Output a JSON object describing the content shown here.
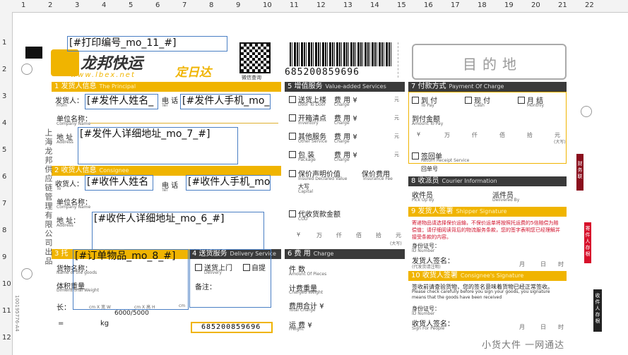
{
  "ruler": {
    "top_numbers": [
      "1",
      "2",
      "3",
      "4",
      "5",
      "6",
      "7",
      "8",
      "9",
      "10",
      "11",
      "12",
      "13",
      "14",
      "15",
      "16",
      "17",
      "18",
      "19",
      "20",
      "21",
      "22"
    ],
    "left_numbers": [
      "1",
      "2",
      "3",
      "4",
      "5",
      "6",
      "7",
      "8",
      "9",
      "10",
      "11",
      "12"
    ]
  },
  "fields": {
    "print_no": "[#打印编号_mo_11_#]",
    "sender_name": "[#发件人姓名_",
    "sender_phone": "[#发件人手机_mo_",
    "sender_address": "[#发件人详细地址_mo_7_#]",
    "recv_name": "[#收件人姓名",
    "recv_phone": "[#收件人手机_mo",
    "recv_address": "[#收件人详细地址_mo_6_#]",
    "goods": "[#订单物品_mo_8_#]"
  },
  "brand": {
    "logo_cn": "龙邦快运",
    "url": "www.lbex.net",
    "slogan": "定日达",
    "qr_caption": "微信查询"
  },
  "waybill": {
    "number": "685200859696",
    "destination": "目的地"
  },
  "principal": {
    "title": "1 发货人信息",
    "title_en": "The Principal",
    "sender": "发货人：",
    "sender_en": "From",
    "phone": "电 话",
    "phone_en": "Tel",
    "company": "单位名称：",
    "company_en": "Company Name",
    "address": "地 址",
    "address_en": "Address"
  },
  "consignee": {
    "title": "2 收货人信息",
    "title_en": "Consignee",
    "receiver": "收货人：",
    "receiver_en": "To",
    "phone": "电 话",
    "phone_en": "Tel",
    "company": "单位名称：",
    "company_en": "Company Name",
    "address": "地 址：",
    "address_en": "Address"
  },
  "section3": {
    "title": "3 托",
    "goods": "货物名称：",
    "goods_en": "Name of the goods",
    "volume": "体积重量",
    "volume_en": "Dimensional Weight",
    "length": "长：",
    "cm_w": "cm X 宽 W",
    "cm_h": "cm X 高 H",
    "cm": "cm",
    "ratio": "6000/5000",
    "eq": "=",
    "kg": "kg"
  },
  "section4": {
    "title": "4 送货服务",
    "title_en": "Delivery Service",
    "door": "送货上门",
    "door_en": "Delivery",
    "pickup": "自提",
    "remark": "备注："
  },
  "section5": {
    "title": "5 增值服务",
    "title_en": "Value-added Services",
    "rows": [
      {
        "label": "送货上楼",
        "en": "Door To Door"
      },
      {
        "label": "开箱清点",
        "en": "Inventory"
      },
      {
        "label": "其他服务",
        "en": "Other Service"
      },
      {
        "label": "包 装",
        "en": "Package"
      }
    ],
    "fee": "费 用",
    "fee_unit": "¥",
    "fee_en": "Charge",
    "yuan": "元",
    "insured": "保价声明价值",
    "insured_en": "Insured Declared Value",
    "insurance_fee": "保价费用",
    "insurance_fee_en": "Insurance Fee",
    "capital": "大写",
    "capital_en": "Capital",
    "cod": "代收货款金额",
    "cod_en": "COD",
    "units": [
      "¥",
      "万",
      "仟",
      "佰",
      "拾",
      "元"
    ],
    "units_cap": "(大写)"
  },
  "section6": {
    "title": "6 费 用",
    "title_en": "Charge",
    "pieces": "件 数",
    "pieces_en": "Amount Of Pieces",
    "weight": "计费重量",
    "weight_en": "Charged Weight",
    "total": "费用合计",
    "total_unit": "¥",
    "total_en": "Total Charge",
    "freight": "运 费",
    "freight_unit": "¥",
    "freight_en": "Freight"
  },
  "section7": {
    "title": "7 付款方式",
    "title_en": "Payment Of Charge",
    "options": [
      {
        "label": "到 付",
        "en": "To Pay"
      },
      {
        "label": "现 付",
        "en": "Cash"
      },
      {
        "label": "月 结",
        "en": "Monthly"
      }
    ],
    "cod_amount": "到付金额",
    "cod_amount_en": "Amount To Pay",
    "units": [
      "¥",
      "万",
      "仟",
      "佰",
      "拾",
      "元"
    ],
    "units_cap": "(大写)",
    "receipt": "签回单",
    "receipt_en": "Return Receipt Service",
    "receipt_no": "回单号"
  },
  "section8": {
    "title": "8 收派员",
    "title_en": "Courier Information",
    "pickup": "收件员",
    "pickup_en": "Pick Up By",
    "deliver": "派件员",
    "deliver_en": "Delivered By"
  },
  "section9": {
    "title": "9 发货人签署",
    "title_en": "Shipper Signature",
    "notice": "寄递物品请选择保价运输，不保价运单将按照托运费的5倍赔偿为赔偿值；请仔细阅读背后的物流服务条款，您的签字表明您已经理解并接受条款的内容。",
    "id": "身份证号：",
    "id_en": "ID Number",
    "sign": "发货人签名：",
    "sign_en": "(代发货请注明)",
    "month": "月",
    "day": "日",
    "hour": "时"
  },
  "section10": {
    "title": "10 收货人签署",
    "title_en": "Consignee's Signature",
    "notice_cn": "签收前请查验货物，您的签名意味着货物已经正常签收。",
    "notice_en": "Please check carefully before you sign your goods, you signature means that the goods have been received",
    "id": "身份证号：",
    "id_en": "ID Number",
    "sign": "收货人签名：",
    "sign_en": "Sign For People",
    "month": "月",
    "day": "日",
    "hour": "时"
  },
  "side": {
    "left_company": "上海龙邦供应链管理有限公司出品",
    "tab_finance": "财务联",
    "tab_receiver": "寄件人存根",
    "tab_shipper": "收件人存根",
    "footer": "小货大件 一网通达",
    "serial": "100195776-A4"
  }
}
